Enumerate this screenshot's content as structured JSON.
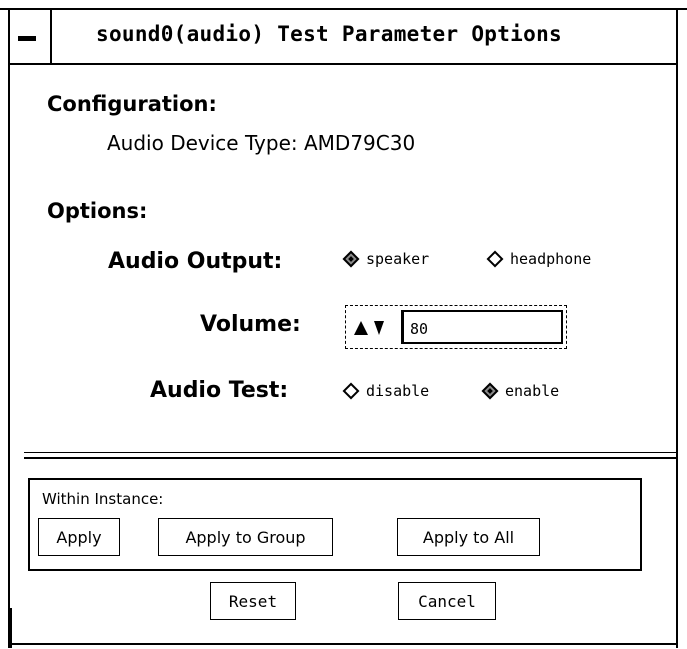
{
  "window": {
    "title": "sound0(audio) Test Parameter Options"
  },
  "configuration": {
    "heading": "Configuration:",
    "device_type": "Audio Device Type: AMD79C30"
  },
  "options": {
    "heading": "Options:",
    "audio_output": {
      "label": "Audio Output:",
      "choices": [
        {
          "label": "speaker",
          "selected": true
        },
        {
          "label": "headphone",
          "selected": false
        }
      ]
    },
    "volume": {
      "label": "Volume:",
      "value": "80"
    },
    "audio_test": {
      "label": "Audio Test:",
      "choices": [
        {
          "label": "disable",
          "selected": false
        },
        {
          "label": "enable",
          "selected": true
        }
      ]
    }
  },
  "instance": {
    "label": "Within Instance:",
    "apply_label": "Apply",
    "apply_group_label": "Apply to Group",
    "apply_all_label": "Apply to All"
  },
  "footer": {
    "reset_label": "Reset",
    "cancel_label": "Cancel"
  }
}
